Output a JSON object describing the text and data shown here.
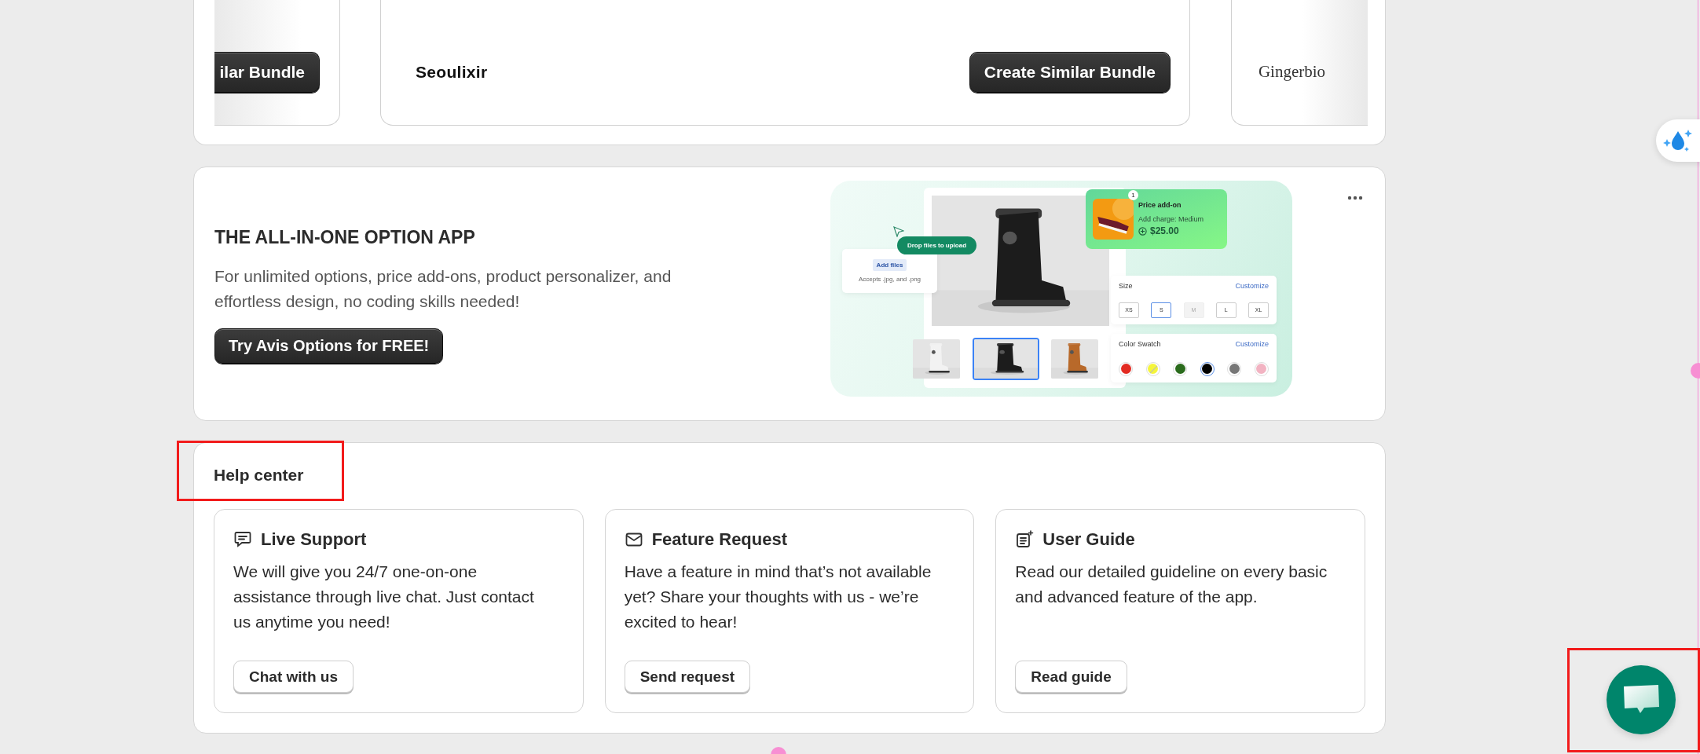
{
  "bundles": [
    {
      "button": "ilar Bundle"
    },
    {
      "brand": "Seoulixir",
      "button": "Create Similar Bundle"
    },
    {
      "brand": "Gingerbio"
    }
  ],
  "promo": {
    "title": "THE ALL-IN-ONE OPTION APP",
    "description": "For unlimited options, price add-ons, product personalizer, and effortless design, no coding skills needed!",
    "button": "Try Avis Options for FREE!",
    "illustration": {
      "upload": {
        "pill": "Drop files to upload",
        "button": "Add files",
        "hint": "Accepts .jpg, and .png"
      },
      "price_addon": {
        "badge": "1",
        "title": "Price add-on",
        "detail": "Add charge: Medium",
        "price": "$25.00"
      },
      "thumbnails": [
        {
          "selected": false
        },
        {
          "selected": true
        },
        {
          "selected": false
        }
      ],
      "size": {
        "title": "Size",
        "action": "Customize",
        "options": [
          {
            "label": "XS",
            "selected": false,
            "disabled": false
          },
          {
            "label": "S",
            "selected": true,
            "disabled": false
          },
          {
            "label": "M",
            "selected": false,
            "disabled": true
          },
          {
            "label": "L",
            "selected": false,
            "disabled": false
          },
          {
            "label": "XL",
            "selected": false,
            "disabled": false
          }
        ]
      },
      "color_swatch": {
        "title": "Color Swatch",
        "action": "Customize",
        "swatches": [
          {
            "color": "#e32b22",
            "selected": false,
            "disabled": false
          },
          {
            "color": "#f5f53a",
            "selected": false,
            "disabled": true
          },
          {
            "color": "#2a6b1c",
            "selected": false,
            "disabled": false
          },
          {
            "color": "#000000",
            "selected": true,
            "disabled": false
          },
          {
            "color": "#777777",
            "selected": false,
            "disabled": false
          },
          {
            "color": "#f2b3c2",
            "selected": false,
            "disabled": false
          }
        ]
      }
    }
  },
  "help_center": {
    "title": "Help center",
    "cards": [
      {
        "kind": "chat",
        "title": "Live Support",
        "text": "We will give you 24/7 one-on-one assistance through live chat. Just contact us anytime you need!",
        "button": "Chat with us"
      },
      {
        "kind": "mail",
        "title": "Feature Request",
        "text": "Have a feature in mind that’s not available yet? Share your thoughts with us - we’re excited to hear!",
        "button": "Send request"
      },
      {
        "kind": "guide",
        "title": "User Guide",
        "text": "Read our detailed guideline on every basic and advanced feature of the app.",
        "button": "Read guide"
      }
    ]
  }
}
